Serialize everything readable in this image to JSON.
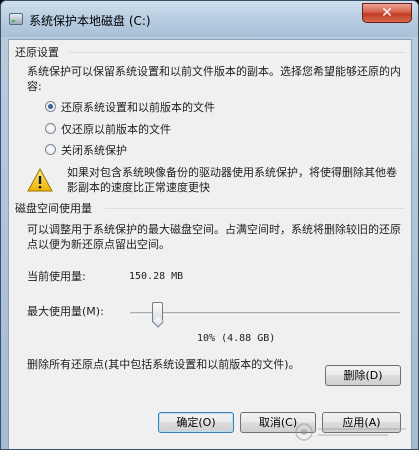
{
  "window": {
    "title": "系统保护本地磁盘 (C:)",
    "close_glyph": "✕"
  },
  "restore_settings": {
    "group_title": "还原设置",
    "description": "系统保护可以保留系统设置和以前文件版本的副本。选择您希望能够还原的内容:",
    "options": [
      {
        "label": "还原系统设置和以前版本的文件",
        "checked": true
      },
      {
        "label": "仅还原以前版本的文件",
        "checked": false
      },
      {
        "label": "关闭系统保护",
        "checked": false
      }
    ],
    "warning_icon": "warning-icon",
    "warning_text": "如果对包含系统映像备份的驱动器使用系统保护，将使得删除其他卷影副本的速度比正常速度更快"
  },
  "disk_usage": {
    "group_title": "磁盘空间使用量",
    "description": "可以调整用于系统保护的最大磁盘空间。占满空间时，系统将删除较旧的还原点以便为新还原点留出空间。",
    "current_label": "当前使用量:",
    "current_value": "150.28 MB",
    "max_label": "最大使用量(M):",
    "slider_value_percent": 10,
    "slider_readout": "10% (4.88 GB)"
  },
  "delete_section": {
    "text": "删除所有还原点(其中包括系统设置和以前版本的文件)。",
    "delete_button": "删除(D)"
  },
  "footer": {
    "ok_button": "确定(O)",
    "cancel_button": "取消(C)",
    "apply_button": "应用(A)"
  },
  "colors": {
    "close_button": "#c23b22",
    "title_bar": "#b5cbe0",
    "client_bg": "#f0f0f0",
    "default_button_border": "#3c7fb1"
  }
}
